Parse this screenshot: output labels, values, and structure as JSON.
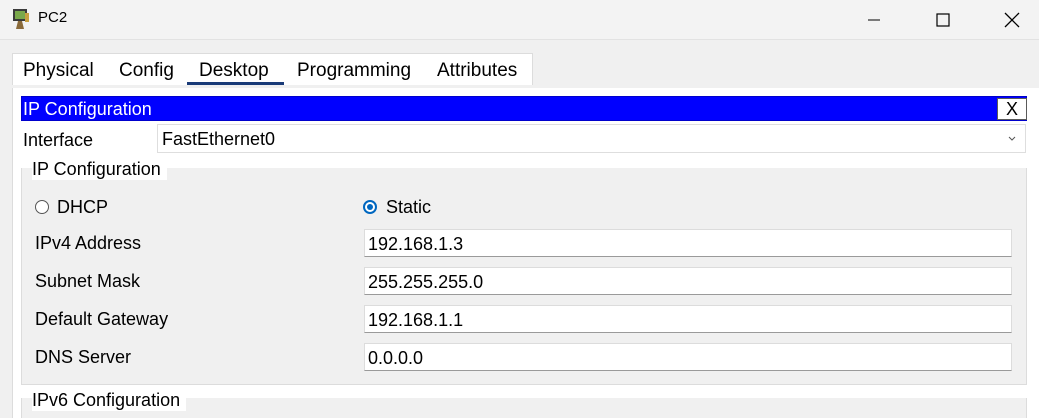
{
  "window": {
    "title": "PC2",
    "icon": "pc-app-icon",
    "controls": [
      "minimize-icon",
      "maximize-icon",
      "close-icon"
    ]
  },
  "tabs": [
    {
      "label": "Physical"
    },
    {
      "label": "Config"
    },
    {
      "label": "Desktop"
    },
    {
      "label": "Programming"
    },
    {
      "label": "Attributes"
    }
  ],
  "active_tab": "Desktop",
  "ip_config": {
    "header_title": "IP Configuration",
    "close_label": "X",
    "interface_label": "Interface",
    "interface_value": "FastEthernet0",
    "group_title": "IP Configuration",
    "dhcp_label": "DHCP",
    "static_label": "Static",
    "selected_mode": "Static",
    "fields": {
      "ipv4_label": "IPv4 Address",
      "ipv4_value": "192.168.1.3",
      "subnet_label": "Subnet Mask",
      "subnet_value": "255.255.255.0",
      "gateway_label": "Default Gateway",
      "gateway_value": "192.168.1.1",
      "dns_label": "DNS Server",
      "dns_value": "0.0.0.0"
    },
    "ipv6_group_title": "IPv6 Configuration"
  },
  "colors": {
    "header_bg": "#0000ff",
    "header_text": "#ffffff",
    "active_tab_underline": "#1a3b78",
    "radio_accent": "#0067c0"
  }
}
